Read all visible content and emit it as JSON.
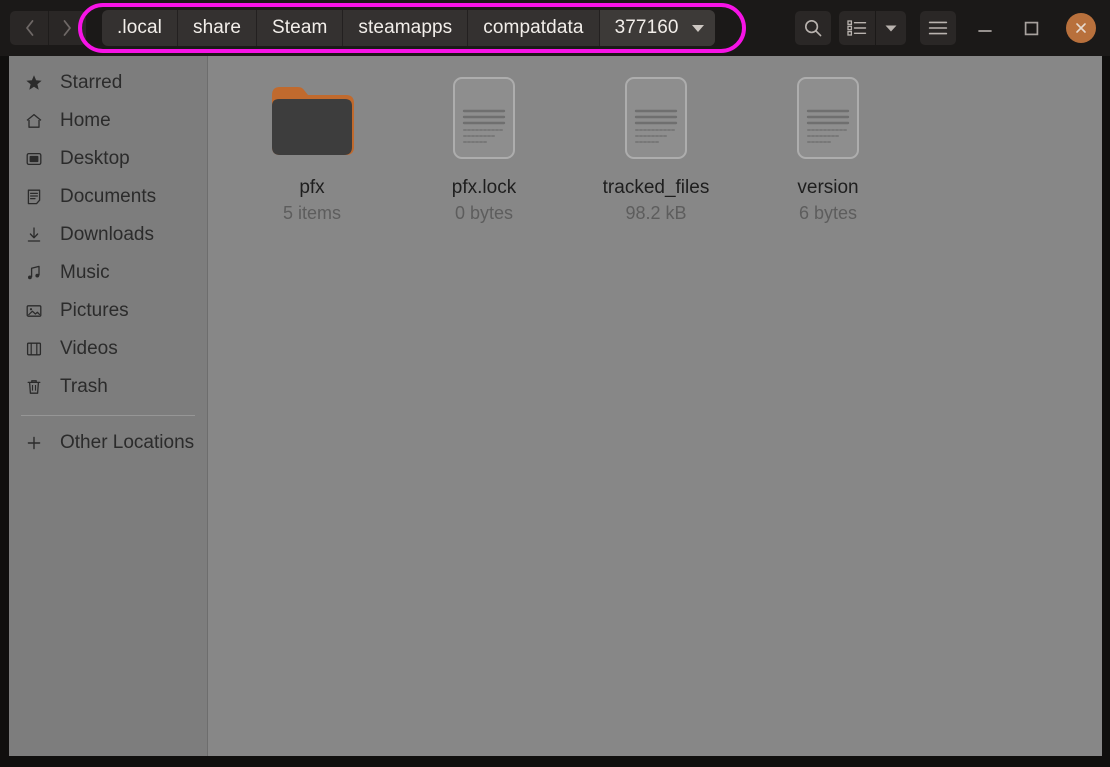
{
  "window": {
    "titlebar_color": "#1b1918",
    "close_button_color": "#b8703c",
    "highlight_color": "#f713e6"
  },
  "nav": {
    "back_label": "Back",
    "forward_label": "Forward"
  },
  "pathbar": {
    "crumbs": [
      {
        "label": ".local",
        "current": false
      },
      {
        "label": "share",
        "current": false
      },
      {
        "label": "Steam",
        "current": false
      },
      {
        "label": "steamapps",
        "current": false
      },
      {
        "label": "compatdata",
        "current": false
      },
      {
        "label": "377160",
        "current": true
      }
    ]
  },
  "toolbar": {
    "search_label": "Search",
    "view_label": "View options",
    "view_dropdown_label": "View options menu",
    "menu_label": "Main menu",
    "minimize_label": "Minimize",
    "maximize_label": "Maximize",
    "close_label": "Close"
  },
  "sidebar": {
    "items": [
      {
        "label": "Starred",
        "icon": "star-icon"
      },
      {
        "label": "Home",
        "icon": "home-icon"
      },
      {
        "label": "Desktop",
        "icon": "desktop-icon"
      },
      {
        "label": "Documents",
        "icon": "documents-icon"
      },
      {
        "label": "Downloads",
        "icon": "downloads-icon"
      },
      {
        "label": "Music",
        "icon": "music-icon"
      },
      {
        "label": "Pictures",
        "icon": "pictures-icon"
      },
      {
        "label": "Videos",
        "icon": "videos-icon"
      },
      {
        "label": "Trash",
        "icon": "trash-icon"
      }
    ],
    "other_locations": {
      "label": "Other Locations",
      "icon": "plus-icon"
    }
  },
  "files": [
    {
      "name": "pfx",
      "meta": "5 items",
      "type": "folder"
    },
    {
      "name": "pfx.lock",
      "meta": "0 bytes",
      "type": "document"
    },
    {
      "name": "tracked_files",
      "meta": "98.2 kB",
      "type": "document"
    },
    {
      "name": "version",
      "meta": "6 bytes",
      "type": "document"
    }
  ]
}
